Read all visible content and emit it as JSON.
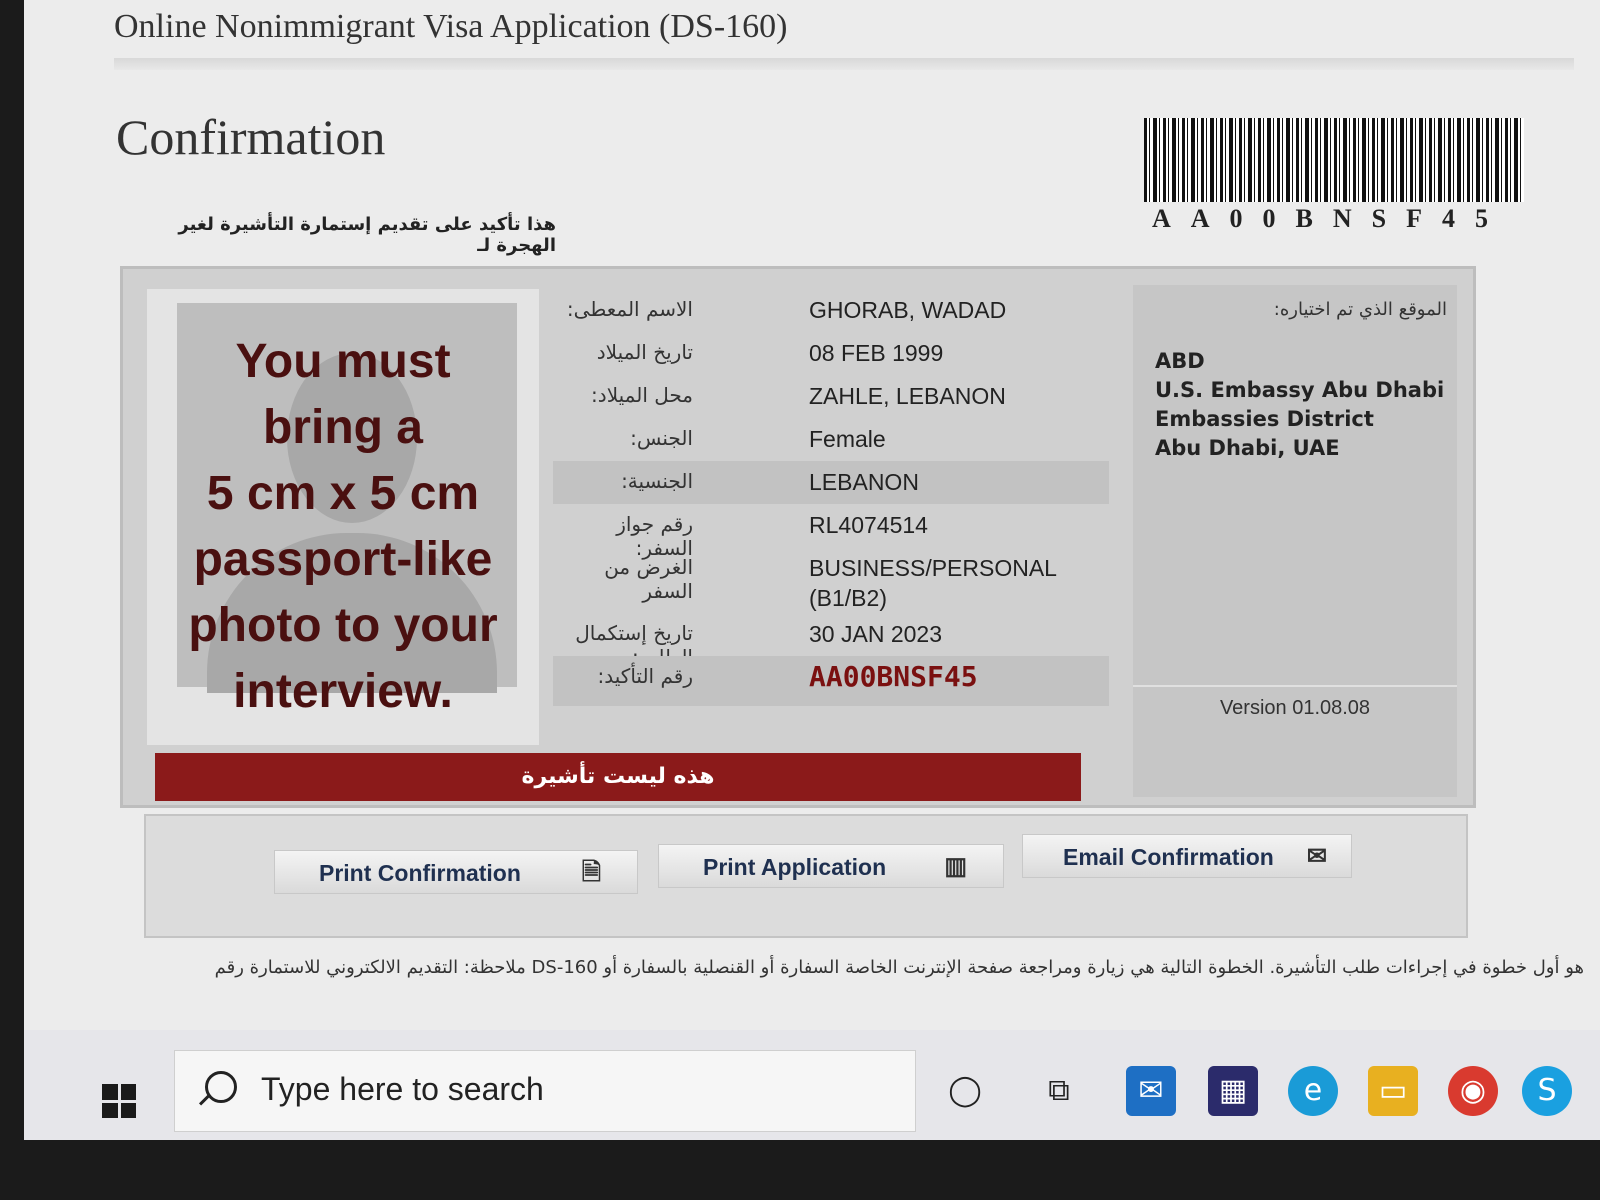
{
  "window": {
    "title": "Online Nonimmigrant Visa Application (DS-160)"
  },
  "page": {
    "title": "Confirmation",
    "subtitle_ar": "هذا تأكيد على تقديم إستمارة التأشيرة لغير الهجرة لـ"
  },
  "barcode": {
    "text": "AA00BNSF45"
  },
  "photo": {
    "message_lines": [
      "You must",
      "bring a",
      "5 cm x 5 cm",
      "passport-like",
      "photo to your",
      "interview."
    ]
  },
  "applicant": {
    "rows": [
      {
        "label": "الاسم المعطى:",
        "value": "GHORAB, WADAD"
      },
      {
        "label": "تاريخ الميلاد",
        "value": "08 FEB 1999"
      },
      {
        "label": "محل الميلاد:",
        "value": "ZAHLE, LEBANON"
      },
      {
        "label": "الجنس:",
        "value": "Female"
      },
      {
        "label": "الجنسية:",
        "value": "LEBANON"
      },
      {
        "label": "رقم جواز السفر:",
        "value": "RL4074514"
      },
      {
        "label": "الغرض من السفر",
        "value": "BUSINESS/PERSONAL (B1/B2)"
      },
      {
        "label": "تاريخ إستكمال الطلب:",
        "value": "30 JAN 2023"
      },
      {
        "label": "رقم التأكيد:",
        "value": "AA00BNSF45"
      }
    ]
  },
  "location": {
    "label_ar": "الموقع الذي تم اختياره:",
    "code": "ABD",
    "name": "U.S. Embassy Abu Dhabi",
    "district": "Embassies District",
    "city": "Abu Dhabi, UAE",
    "version": "Version 01.08.08"
  },
  "banner": {
    "text_ar": "هذه ليست تأشيرة"
  },
  "buttons": {
    "print_confirmation": "Print Confirmation",
    "print_application": "Print Application",
    "email_confirmation": "Email Confirmation"
  },
  "footer": {
    "line1_ar": "هو أول خطوة في إجراءات طلب التأشيرة. الخطوة التالية هي زيارة ومراجعة صفحة الإنترنت الخاصة السفارة أو القنصلية بالسفارة أو DS-160 ملاحظة: التقديم الالكتروني للاستمارة رقم"
  },
  "taskbar": {
    "search_placeholder": "Type here to search",
    "icons": [
      "cortana-icon",
      "task-view-icon",
      "mail-icon",
      "store-icon",
      "edge-icon",
      "file-explorer-icon",
      "chrome-icon",
      "skype-icon"
    ]
  }
}
